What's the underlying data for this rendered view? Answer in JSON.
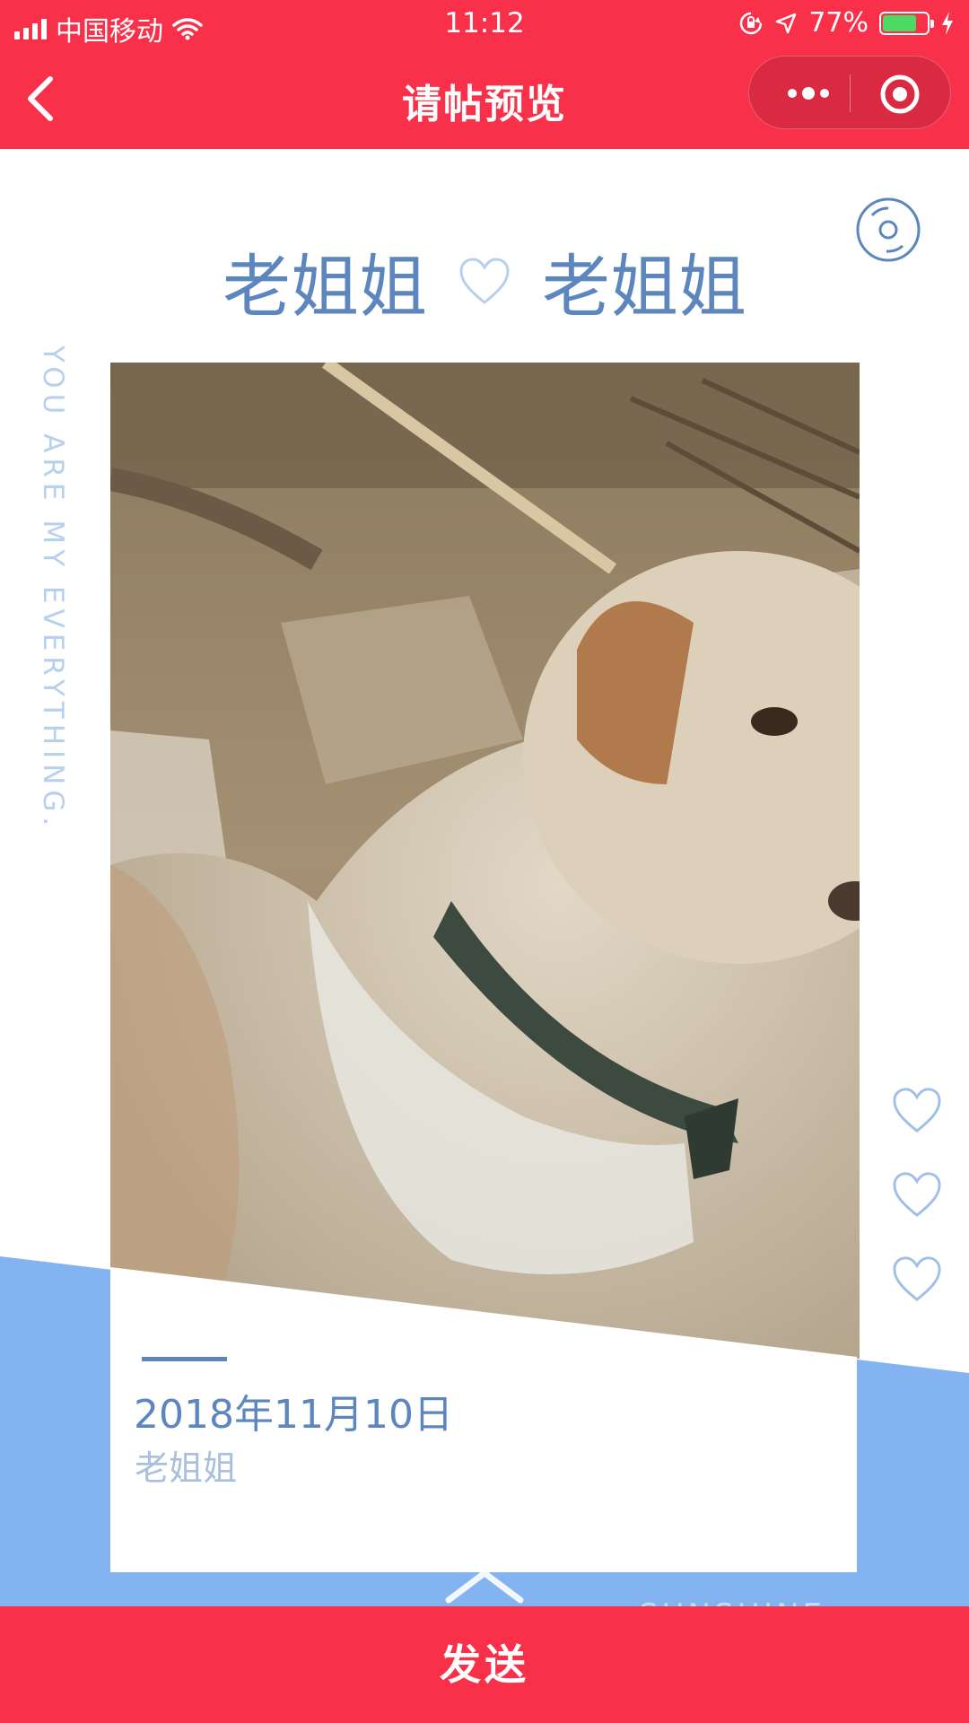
{
  "status_bar": {
    "carrier": "中国移动",
    "time": "11:12",
    "battery_percent": "77%",
    "battery_level": 0.77,
    "icons": [
      "signal-icon",
      "wifi-icon",
      "orientation-lock-icon",
      "location-icon",
      "battery-icon",
      "charging-icon"
    ]
  },
  "nav": {
    "title": "请帖预览",
    "icons": [
      "back-chevron-icon",
      "more-dots-icon",
      "close-target-icon"
    ]
  },
  "invite": {
    "name_left": "老姐姐",
    "name_right": "老姐姐",
    "tagline": "YOU ARE MY EVERYTHING.",
    "date": "2018年11月10日",
    "host": "老姐姐",
    "photo_subject": "dog",
    "watermark": "SUNSHINE",
    "icons": [
      "music-disc-icon",
      "heart-outline-icon",
      "chevron-up-icon"
    ]
  },
  "actions": {
    "send_label": "发送"
  },
  "colors": {
    "brand_red": "#f8304a",
    "accent_blue": "#5d86bf",
    "band_blue": "#83b3f1",
    "light_blue": "#b7d0ee"
  }
}
